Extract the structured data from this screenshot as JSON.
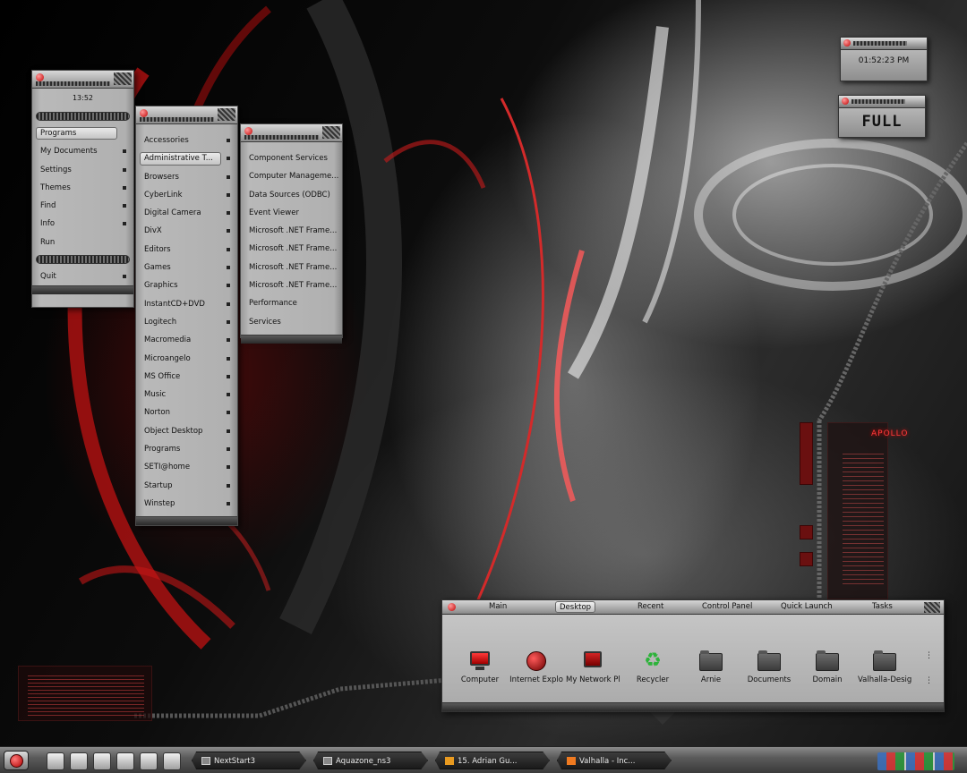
{
  "main_menu": {
    "clock": "13:52",
    "items": [
      {
        "label": "Programs",
        "arrow": false,
        "selected": true
      },
      {
        "label": "My Documents",
        "arrow": true
      },
      {
        "label": "Settings",
        "arrow": true
      },
      {
        "label": "Themes",
        "arrow": true
      },
      {
        "label": "Find",
        "arrow": true
      },
      {
        "label": "Info",
        "arrow": true
      },
      {
        "label": "Run",
        "arrow": false
      }
    ],
    "quit_label": "Quit"
  },
  "programs_menu": {
    "items": [
      {
        "label": "Accessories"
      },
      {
        "label": "Administrative T..."
      },
      {
        "label": "Browsers"
      },
      {
        "label": "CyberLink"
      },
      {
        "label": "Digital Camera"
      },
      {
        "label": "DivX"
      },
      {
        "label": "Editors"
      },
      {
        "label": "Games"
      },
      {
        "label": "Graphics"
      },
      {
        "label": "InstantCD+DVD"
      },
      {
        "label": "Logitech"
      },
      {
        "label": "Macromedia"
      },
      {
        "label": "Microangelo"
      },
      {
        "label": "MS Office"
      },
      {
        "label": "Music"
      },
      {
        "label": "Norton"
      },
      {
        "label": "Object Desktop"
      },
      {
        "label": "Programs"
      },
      {
        "label": "SETI@home"
      },
      {
        "label": "Startup"
      },
      {
        "label": "Winstep"
      }
    ]
  },
  "admin_menu": {
    "items": [
      {
        "label": "Component Services"
      },
      {
        "label": "Computer Manageme..."
      },
      {
        "label": "Data Sources (ODBC)"
      },
      {
        "label": "Event Viewer"
      },
      {
        "label": "Microsoft .NET Frame..."
      },
      {
        "label": "Microsoft .NET Frame..."
      },
      {
        "label": "Microsoft .NET Frame..."
      },
      {
        "label": "Microsoft .NET Frame..."
      },
      {
        "label": "Performance"
      },
      {
        "label": "Services"
      }
    ]
  },
  "clock_widget": {
    "time": "01:52:23 PM"
  },
  "full_widget": {
    "label": "FULL"
  },
  "apollo": {
    "title": "APOLLO"
  },
  "launcher": {
    "tabs": [
      "Main",
      "Desktop",
      "Recent",
      "Control Panel",
      "Quick Launch",
      "Tasks"
    ],
    "active_tab": "Desktop",
    "icons": [
      {
        "label": "Computer",
        "icon": "computer-icon"
      },
      {
        "label": "Internet Explo",
        "icon": "globe-icon"
      },
      {
        "label": "My Network Pl",
        "icon": "network-icon"
      },
      {
        "label": "Recycler",
        "icon": "recycle-icon"
      },
      {
        "label": "Arnie",
        "icon": "folder-icon"
      },
      {
        "label": "Documents",
        "icon": "folder-icon"
      },
      {
        "label": "Domain",
        "icon": "folder-icon"
      },
      {
        "label": "Valhalla-Desig",
        "icon": "folder-icon"
      }
    ]
  },
  "taskbar": {
    "tasks": [
      {
        "label": "NextStart3",
        "icon": "folder-icon"
      },
      {
        "label": "Aquazone_ns3",
        "icon": "folder-icon"
      },
      {
        "label": "15. Adrian Gu...",
        "icon": "winamp-icon"
      },
      {
        "label": "Valhalla - Inc...",
        "icon": "mail-icon"
      }
    ]
  },
  "colors": {
    "accent": "#cc0000",
    "panel": "#b0b0b0",
    "apollo_text": "#ff3a3a"
  }
}
